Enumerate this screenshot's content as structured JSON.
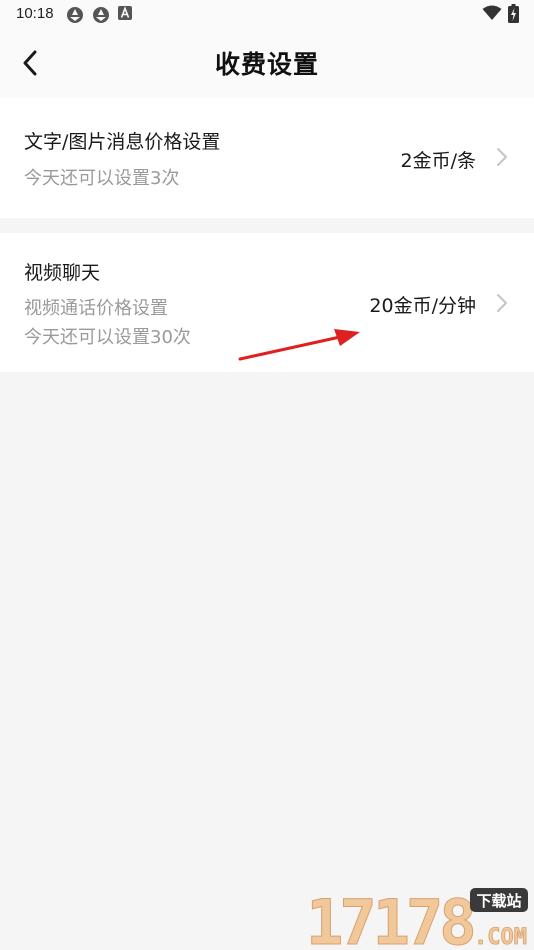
{
  "status_bar": {
    "time": "10:18",
    "left_icons": [
      "aperture-icon",
      "aperture-icon",
      "app-a-icon"
    ],
    "right_icons": [
      "wifi-icon",
      "battery-charging-icon"
    ]
  },
  "header": {
    "title": "收费设置",
    "back_icon": "chevron-left-icon"
  },
  "settings": [
    {
      "title": "文字/图片消息价格设置",
      "sub_lines": [
        "今天还可以设置3次"
      ],
      "value": "2金币/条"
    },
    {
      "title": "视频聊天",
      "sub_lines": [
        "视频通话价格设置",
        "今天还可以设置30次"
      ],
      "value": "20金币/分钟"
    }
  ],
  "annotation": {
    "type": "red-arrow",
    "color": "#e02020"
  },
  "watermark": {
    "text": "17178",
    "badge": "下载站",
    "suffix": ".COM"
  },
  "colors": {
    "background": "#f5f5f5",
    "card": "#ffffff",
    "text_primary": "#1a1a1a",
    "text_secondary": "#9a9a9a",
    "chevron": "#c4c4c4"
  }
}
